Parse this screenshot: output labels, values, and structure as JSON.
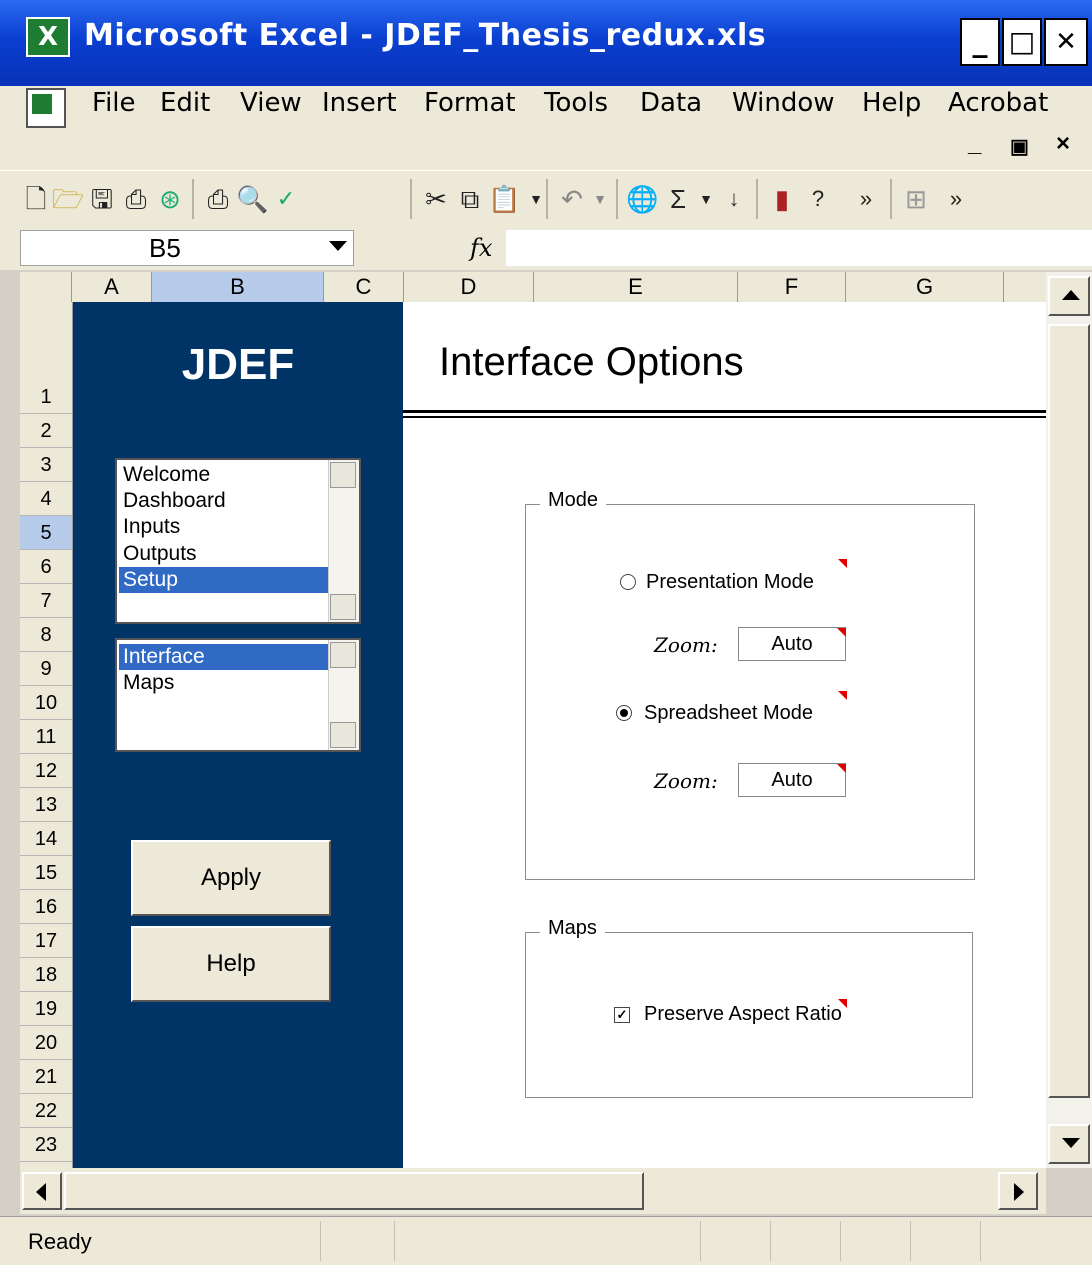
{
  "window": {
    "title": "Microsoft Excel - JDEF_Thesis_redux.xls",
    "minimize": "_",
    "maximize": "□",
    "close": "✕"
  },
  "menu": {
    "items": [
      "File",
      "Edit",
      "View",
      "Insert",
      "Format",
      "Tools",
      "Data",
      "Window",
      "Help",
      "Acrobat"
    ],
    "doc_minimize": "_",
    "doc_restore": "🗗",
    "doc_close": "×"
  },
  "toolbar": {
    "icons": [
      "new-icon",
      "open-icon",
      "save-icon",
      "permission-icon",
      "research-icon",
      "print-icon",
      "print-preview-icon",
      "spelling-icon",
      "cut-icon",
      "copy-icon",
      "paste-icon",
      "undo-icon",
      "hyperlink-icon",
      "autosum-icon",
      "sort-ascending-icon",
      "chart-wizard-icon",
      "help-icon",
      "more-icon",
      "borders-icon",
      "more-icon"
    ]
  },
  "formula_bar": {
    "name_box": "B5",
    "fx": "fx",
    "value": ""
  },
  "sheet": {
    "columns": [
      "A",
      "B",
      "C",
      "D",
      "E",
      "F",
      "G"
    ],
    "rows": [
      "1",
      "2",
      "3",
      "4",
      "5",
      "6",
      "7",
      "8",
      "9",
      "10",
      "11",
      "12",
      "13",
      "14",
      "15",
      "16",
      "17",
      "18",
      "19",
      "20",
      "21",
      "22",
      "23"
    ],
    "selected_row": "5",
    "selected_column": "B"
  },
  "nav": {
    "brand": "JDEF",
    "main_list": [
      "Welcome",
      "Dashboard",
      "Inputs",
      "Outputs",
      "Setup"
    ],
    "main_selected": "Setup",
    "sub_list": [
      "Interface",
      "Maps"
    ],
    "sub_selected": "Interface",
    "apply_label": "Apply",
    "help_label": "Help"
  },
  "content": {
    "title": "Interface Options",
    "mode_group": {
      "label": "Mode",
      "presentation_label": "Presentation Mode",
      "presentation_selected": false,
      "presentation_zoom_label": "Zoom:",
      "presentation_zoom_value": "Auto",
      "spreadsheet_label": "Spreadsheet Mode",
      "spreadsheet_selected": true,
      "spreadsheet_zoom_label": "Zoom:",
      "spreadsheet_zoom_value": "Auto"
    },
    "maps_group": {
      "label": "Maps",
      "aspect_label": "Preserve Aspect Ratio",
      "aspect_checked": true
    }
  },
  "status": {
    "text": "Ready"
  },
  "colors": {
    "title_bar": "#0a3fd0",
    "nav_panel": "#003366",
    "selection": "#316ac5",
    "comment_marker": "#e00000"
  }
}
